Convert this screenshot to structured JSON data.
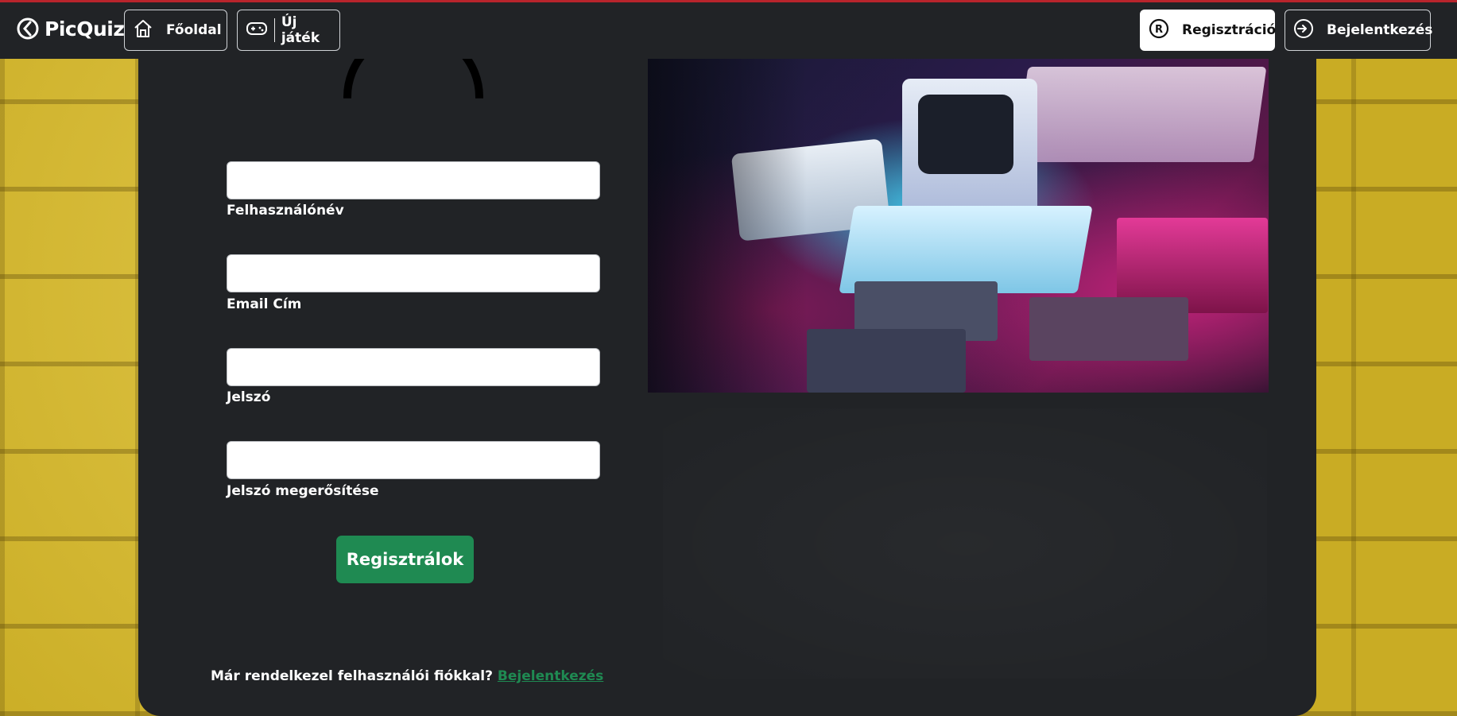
{
  "navbar": {
    "brand": "PicQuiz",
    "home_label": "Főoldal",
    "new_game_label": "Új játék",
    "register_label": "Regisztráció",
    "login_label": "Bejelentkezés"
  },
  "form": {
    "username_label": "Felhasználónév",
    "email_label": "Email Cím",
    "password_label": "Jelszó",
    "password_confirm_label": "Jelszó megerősítése",
    "username_value": "",
    "email_value": "",
    "password_value": "",
    "password_confirm_value": "",
    "submit_label": "Regisztrálok"
  },
  "footer": {
    "question": "Már rendelkezel felhasználói fiókkal?",
    "login_link": "Bejelentkezés"
  },
  "colors": {
    "accent_green": "#1f8a52",
    "panel_bg": "#212326",
    "top_border": "#b8242c"
  },
  "icons": {
    "brand": "picquiz-logo-icon",
    "home": "home-icon",
    "new_game": "gamepad-icon",
    "register": "registered-icon",
    "login": "login-icon"
  }
}
